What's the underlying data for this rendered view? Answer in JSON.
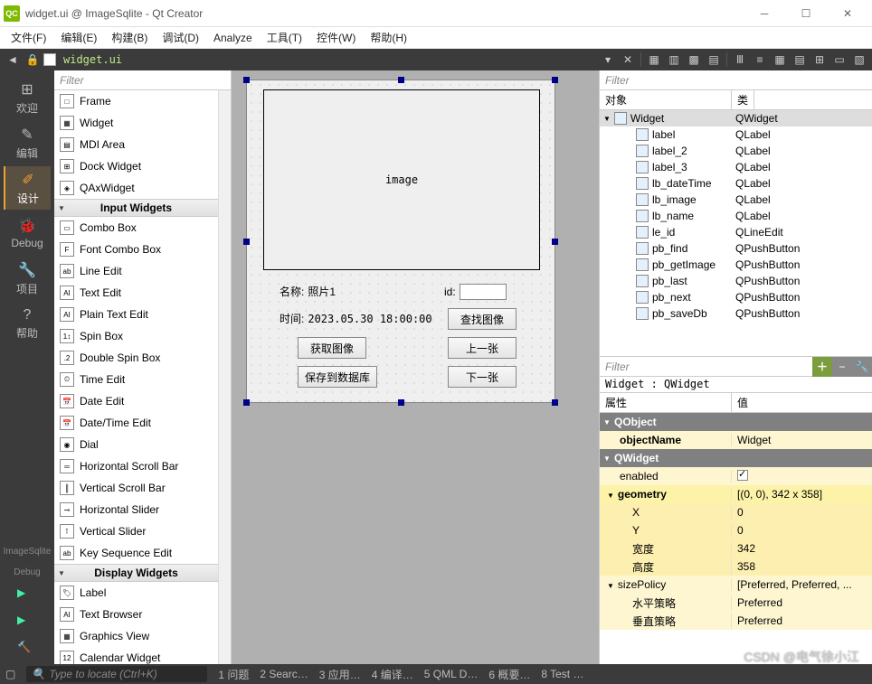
{
  "window": {
    "title": "widget.ui @ ImageSqlite - Qt Creator"
  },
  "menu": [
    "文件(F)",
    "编辑(E)",
    "构建(B)",
    "调试(D)",
    "Analyze",
    "工具(T)",
    "控件(W)",
    "帮助(H)"
  ],
  "doc_tab": "widget.ui",
  "leftbar": {
    "items": [
      {
        "icon": "⊞",
        "label": "欢迎"
      },
      {
        "icon": "✎",
        "label": "编辑"
      },
      {
        "icon": "✐",
        "label": "设计",
        "active": true
      },
      {
        "icon": "🐞",
        "label": "Debug"
      },
      {
        "icon": "🔧",
        "label": "项目"
      },
      {
        "icon": "?",
        "label": "帮助"
      }
    ],
    "project": "ImageSqlite",
    "config": "Debug"
  },
  "widgetbox": {
    "filter_placeholder": "Filter",
    "items1": [
      {
        "icon": "□",
        "label": "Frame"
      },
      {
        "icon": "▦",
        "label": "Widget"
      },
      {
        "icon": "▤",
        "label": "MDI Area"
      },
      {
        "icon": "⊞",
        "label": "Dock Widget"
      },
      {
        "icon": "◈",
        "label": "QAxWidget"
      }
    ],
    "cat1": "Input Widgets",
    "items2": [
      {
        "icon": "▭",
        "label": "Combo Box"
      },
      {
        "icon": "F",
        "label": "Font Combo Box"
      },
      {
        "icon": "ab",
        "label": "Line Edit"
      },
      {
        "icon": "AI",
        "label": "Text Edit"
      },
      {
        "icon": "AI",
        "label": "Plain Text Edit"
      },
      {
        "icon": "1↕",
        "label": "Spin Box"
      },
      {
        "icon": ".2",
        "label": "Double Spin Box"
      },
      {
        "icon": "⏲",
        "label": "Time Edit"
      },
      {
        "icon": "📅",
        "label": "Date Edit"
      },
      {
        "icon": "📅",
        "label": "Date/Time Edit"
      },
      {
        "icon": "◉",
        "label": "Dial"
      },
      {
        "icon": "═",
        "label": "Horizontal Scroll Bar"
      },
      {
        "icon": "║",
        "label": "Vertical Scroll Bar"
      },
      {
        "icon": "⊸",
        "label": "Horizontal Slider"
      },
      {
        "icon": "⊺",
        "label": "Vertical Slider"
      },
      {
        "icon": "ab",
        "label": "Key Sequence Edit"
      }
    ],
    "cat2": "Display Widgets",
    "items3": [
      {
        "icon": "🏷",
        "label": "Label"
      },
      {
        "icon": "AI",
        "label": "Text Browser"
      },
      {
        "icon": "▦",
        "label": "Graphics View"
      },
      {
        "icon": "12",
        "label": "Calendar Widget"
      }
    ]
  },
  "form": {
    "image_text": "image",
    "name_label": "名称:",
    "name_value": "照片1",
    "id_label": "id:",
    "time_label": "时间:",
    "time_value": "2023.05.30 18:00:00",
    "btn_find": "查找图像",
    "btn_get": "获取图像",
    "btn_prev": "上一张",
    "btn_save": "保存到数据库",
    "btn_next": "下一张"
  },
  "objtree": {
    "filter_placeholder": "Filter",
    "h1": "对象",
    "h2": "类",
    "rows": [
      {
        "name": "Widget",
        "cls": "QWidget",
        "root": true
      },
      {
        "name": "label",
        "cls": "QLabel"
      },
      {
        "name": "label_2",
        "cls": "QLabel"
      },
      {
        "name": "label_3",
        "cls": "QLabel"
      },
      {
        "name": "lb_dateTime",
        "cls": "QLabel"
      },
      {
        "name": "lb_image",
        "cls": "QLabel"
      },
      {
        "name": "lb_name",
        "cls": "QLabel"
      },
      {
        "name": "le_id",
        "cls": "QLineEdit"
      },
      {
        "name": "pb_find",
        "cls": "QPushButton"
      },
      {
        "name": "pb_getImage",
        "cls": "QPushButton"
      },
      {
        "name": "pb_last",
        "cls": "QPushButton"
      },
      {
        "name": "pb_next",
        "cls": "QPushButton"
      },
      {
        "name": "pb_saveDb",
        "cls": "QPushButton"
      }
    ]
  },
  "props": {
    "filter_placeholder": "Filter",
    "path": "Widget : QWidget",
    "h1": "属性",
    "h2": "值",
    "cat1": "QObject",
    "objectName_k": "objectName",
    "objectName_v": "Widget",
    "cat2": "QWidget",
    "enabled_k": "enabled",
    "geometry_k": "geometry",
    "geometry_v": "[(0, 0), 342 x 358]",
    "x_k": "X",
    "x_v": "0",
    "y_k": "Y",
    "y_v": "0",
    "w_k": "宽度",
    "w_v": "342",
    "h_k": "高度",
    "h_v": "358",
    "sp_k": "sizePolicy",
    "sp_v": "[Preferred, Preferred, ...",
    "hp_k": "水平策略",
    "hp_v": "Preferred",
    "vp_k": "垂直策略",
    "vp_v": "Preferred"
  },
  "status": {
    "locate": "Type to locate (Ctrl+K)",
    "items": [
      "1 问题",
      "2 Searc…",
      "3 应用…",
      "4 编译…",
      "5 QML D…",
      "6 概要…",
      "8 Test …"
    ]
  },
  "watermark": "CSDN @电气徐小江"
}
